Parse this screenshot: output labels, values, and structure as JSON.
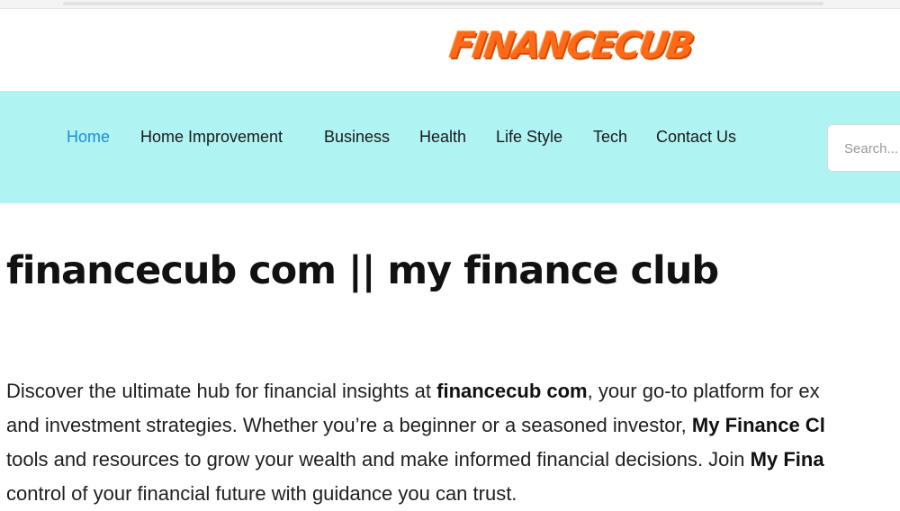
{
  "site": {
    "logo_text": "FINANCECUB"
  },
  "nav": {
    "items": [
      {
        "label": "Home"
      },
      {
        "label": "Home Improvement"
      },
      {
        "label": "Business"
      },
      {
        "label": "Health"
      },
      {
        "label": "Life Style"
      },
      {
        "label": "Tech"
      },
      {
        "label": "Contact Us"
      }
    ],
    "active": "Home",
    "search_placeholder": "Search..."
  },
  "article": {
    "title": "financecub com || my finance club",
    "paragraph": {
      "l1_a": "Discover the ultimate hub for financial insights at ",
      "l1_b": "financecub com",
      "l1_c": ", your go-to platform for ex",
      "l2_a": "and investment strategies. Whether you’re a beginner or a seasoned investor, ",
      "l2_b": "My Finance Cl",
      "l3_a": "tools and resources to grow your wealth and make informed financial decisions. Join ",
      "l3_b": "My Fina",
      "l4_a": "control of your financial future with guidance you can trust."
    }
  },
  "colors": {
    "nav_background": "#aff3f3",
    "nav_active": "#1e8ecf",
    "logo": "#ff6a1a"
  }
}
